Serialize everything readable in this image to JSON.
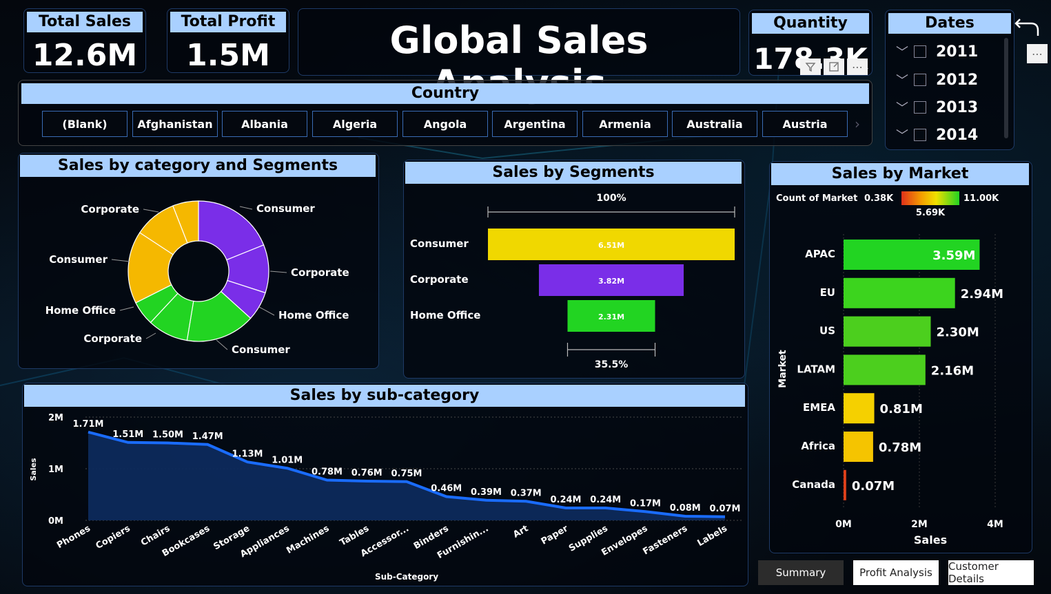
{
  "kpis": {
    "total_sales": {
      "label": "Total Sales",
      "value": "12.6M"
    },
    "total_profit": {
      "label": "Total Profit",
      "value": "1.5M"
    },
    "quantity": {
      "label": "Quantity",
      "value": "178.3K"
    }
  },
  "title": "Global Sales Analysis",
  "country_slicer": {
    "header": "Country",
    "items": [
      "(Blank)",
      "Afghanistan",
      "Albania",
      "Algeria",
      "Angola",
      "Argentina",
      "Armenia",
      "Australia",
      "Austria"
    ]
  },
  "dates_slicer": {
    "header": "Dates",
    "items": [
      "2011",
      "2012",
      "2013",
      "2014"
    ]
  },
  "visual_header_icons": [
    "filter-icon",
    "focus-mode-icon",
    "more-options-icon"
  ],
  "tabs": [
    "Summary",
    "Profit Analysis",
    "Customer Details"
  ],
  "colors": {
    "header_bg": "#a9d0ff",
    "yellow": "#f5b800",
    "purple": "#7a2ee8",
    "green": "#22d422",
    "bright_yellow": "#f0d800",
    "area_fill": "#0d2a5c",
    "line": "#1a6cff"
  },
  "chart_data": [
    {
      "type": "pie",
      "title": "Sales by category and Segments",
      "donut": true,
      "segments": [
        {
          "category": "Consumer",
          "color": "#7a2ee8",
          "slices": [
            {
              "label": "Consumer",
              "value": 2.39
            },
            {
              "label": "Corporate",
              "value": 1.4
            },
            {
              "label": "Home Office",
              "value": 0.85
            }
          ]
        },
        {
          "category": "Home Office",
          "color": "#22d422",
          "slices": [
            {
              "label": "Consumer",
              "value": 2.01
            },
            {
              "label": "Corporate",
              "value": 1.18
            },
            {
              "label": "Home Office",
              "value": 0.71
            }
          ]
        },
        {
          "category": "Corporate",
          "color": "#f5b800",
          "slices": [
            {
              "label": "Consumer",
              "value": 2.11
            },
            {
              "label": "Corporate",
              "value": 1.24
            },
            {
              "label": "Home Office",
              "value": 0.75
            }
          ]
        }
      ],
      "slice_labels": [
        "Consumer",
        "Corporate",
        "Home Office",
        "Consumer",
        "Corporate",
        "Home Office",
        "Consumer",
        "Corporate"
      ]
    },
    {
      "type": "bar",
      "subtype": "funnel",
      "title": "Sales by Segments",
      "categories": [
        "Consumer",
        "Corporate",
        "Home Office"
      ],
      "values": [
        6.51,
        3.82,
        2.31
      ],
      "value_labels": [
        "6.51M",
        "3.82M",
        "2.31M"
      ],
      "colors": [
        "#f0d800",
        "#7a2ee8",
        "#22d422"
      ],
      "top_percent": "100%",
      "bottom_percent": "35.5%"
    },
    {
      "type": "bar",
      "orientation": "horizontal",
      "title": "Sales by Market",
      "categories": [
        "APAC",
        "EU",
        "US",
        "LATAM",
        "EMEA",
        "Africa",
        "Canada"
      ],
      "values": [
        3.59,
        2.94,
        2.3,
        2.16,
        0.81,
        0.78,
        0.07
      ],
      "value_labels": [
        "3.59M",
        "2.94M",
        "2.30M",
        "2.16M",
        "0.81M",
        "0.78M",
        "0.07M"
      ],
      "colors": [
        "#22d422",
        "#3cd41e",
        "#4ccf1e",
        "#4ccf1e",
        "#f5d000",
        "#f5c400",
        "#e0401a"
      ],
      "xlabel": "Sales",
      "ylabel": "Market",
      "xticks": [
        "0M",
        "2M",
        "4M"
      ],
      "xlim": [
        0,
        4
      ],
      "legend": {
        "title": "Count of Market",
        "min": "0.38K",
        "mid": "5.69K",
        "max": "11.00K"
      }
    },
    {
      "type": "area",
      "title": "Sales by sub-category",
      "categories": [
        "Phones",
        "Copiers",
        "Chairs",
        "Bookcases",
        "Storage",
        "Appliances",
        "Machines",
        "Tables",
        "Accessor...",
        "Binders",
        "Furnishin...",
        "Art",
        "Paper",
        "Supplies",
        "Envelopes",
        "Fasteners",
        "Labels"
      ],
      "values": [
        1.71,
        1.51,
        1.5,
        1.47,
        1.13,
        1.01,
        0.78,
        0.76,
        0.75,
        0.46,
        0.39,
        0.37,
        0.24,
        0.24,
        0.17,
        0.08,
        0.07
      ],
      "value_labels": [
        "1.71M",
        "1.51M",
        "1.50M",
        "1.47M",
        "1.13M",
        "1.01M",
        "0.78M",
        "0.76M",
        "0.75M",
        "0.46M",
        "0.39M",
        "0.37M",
        "0.24M",
        "0.24M",
        "0.17M",
        "0.08M",
        "0.07M"
      ],
      "xlabel": "Sub-Category",
      "ylabel": "Sales",
      "yticks": [
        "0M",
        "1M",
        "2M"
      ],
      "ylim": [
        0,
        2
      ]
    }
  ]
}
